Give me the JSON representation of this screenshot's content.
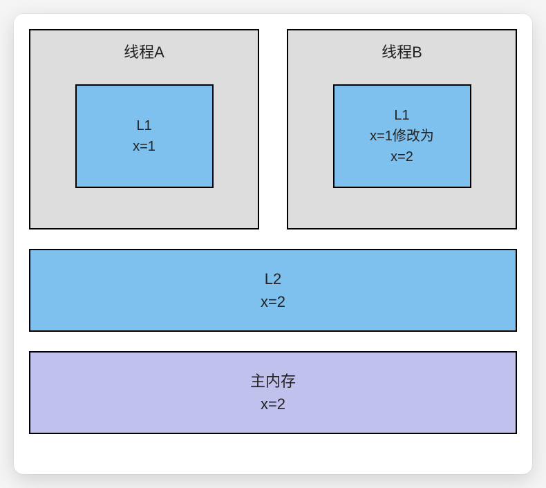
{
  "threads": {
    "a": {
      "title": "线程A",
      "l1_label": "L1",
      "l1_value": "x=1"
    },
    "b": {
      "title": "线程B",
      "l1_label": "L1",
      "l1_line1": "x=1修改为",
      "l1_line2": "x=2"
    }
  },
  "l2": {
    "label": "L2",
    "value": "x=2"
  },
  "memory": {
    "label": "主内存",
    "value": "x=2"
  }
}
